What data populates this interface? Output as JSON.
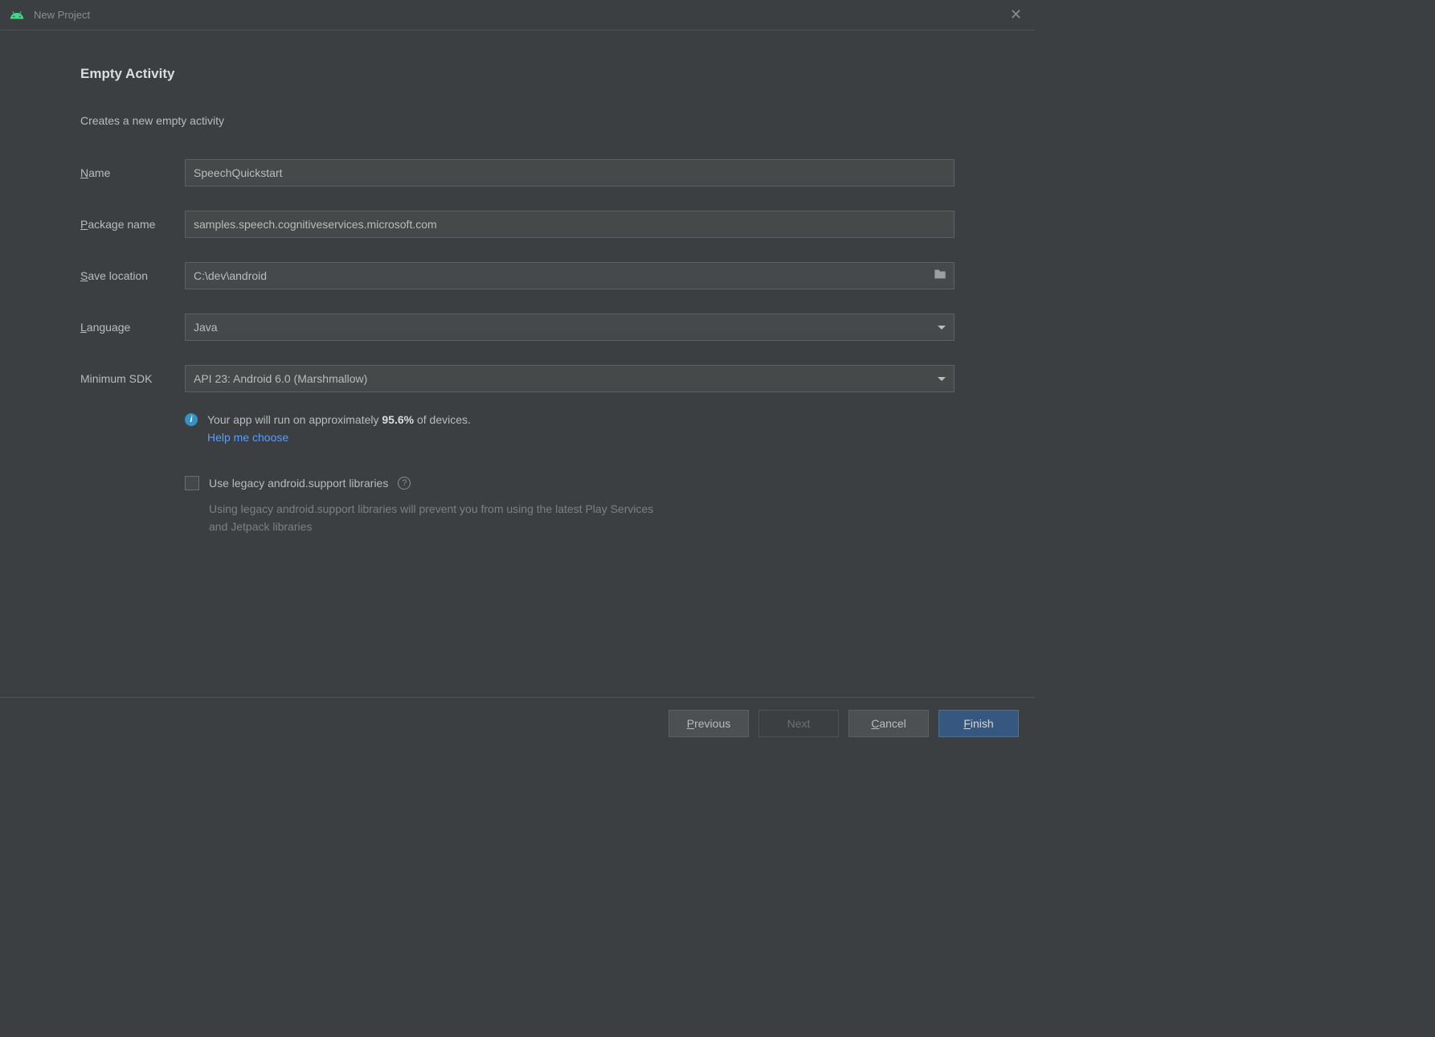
{
  "window": {
    "title": "New Project"
  },
  "page": {
    "heading": "Empty Activity",
    "description": "Creates a new empty activity"
  },
  "fields": {
    "name": {
      "label_pre": "N",
      "label_rest": "ame",
      "value": "SpeechQuickstart"
    },
    "package": {
      "label_pre": "P",
      "label_rest": "ackage name",
      "value": "samples.speech.cognitiveservices.microsoft.com"
    },
    "save": {
      "label_pre": "S",
      "label_rest": "ave location",
      "value": "C:\\dev\\android"
    },
    "language": {
      "label_pre": "L",
      "label_rest": "anguage",
      "value": "Java"
    },
    "minsdk": {
      "label": "Minimum SDK",
      "value": "API 23: Android 6.0 (Marshmallow)"
    }
  },
  "info": {
    "prefix": "Your app will run on approximately ",
    "percent": "95.6%",
    "suffix": " of devices.",
    "help_link": "Help me choose"
  },
  "legacy": {
    "label": "Use legacy android.support libraries",
    "hint": "Using legacy android.support libraries will prevent you from using the latest Play Services and Jetpack libraries"
  },
  "buttons": {
    "previous_pre": "P",
    "previous_rest": "revious",
    "next": "Next",
    "cancel_pre": "C",
    "cancel_rest": "ancel",
    "finish_pre": "F",
    "finish_rest": "inish"
  }
}
